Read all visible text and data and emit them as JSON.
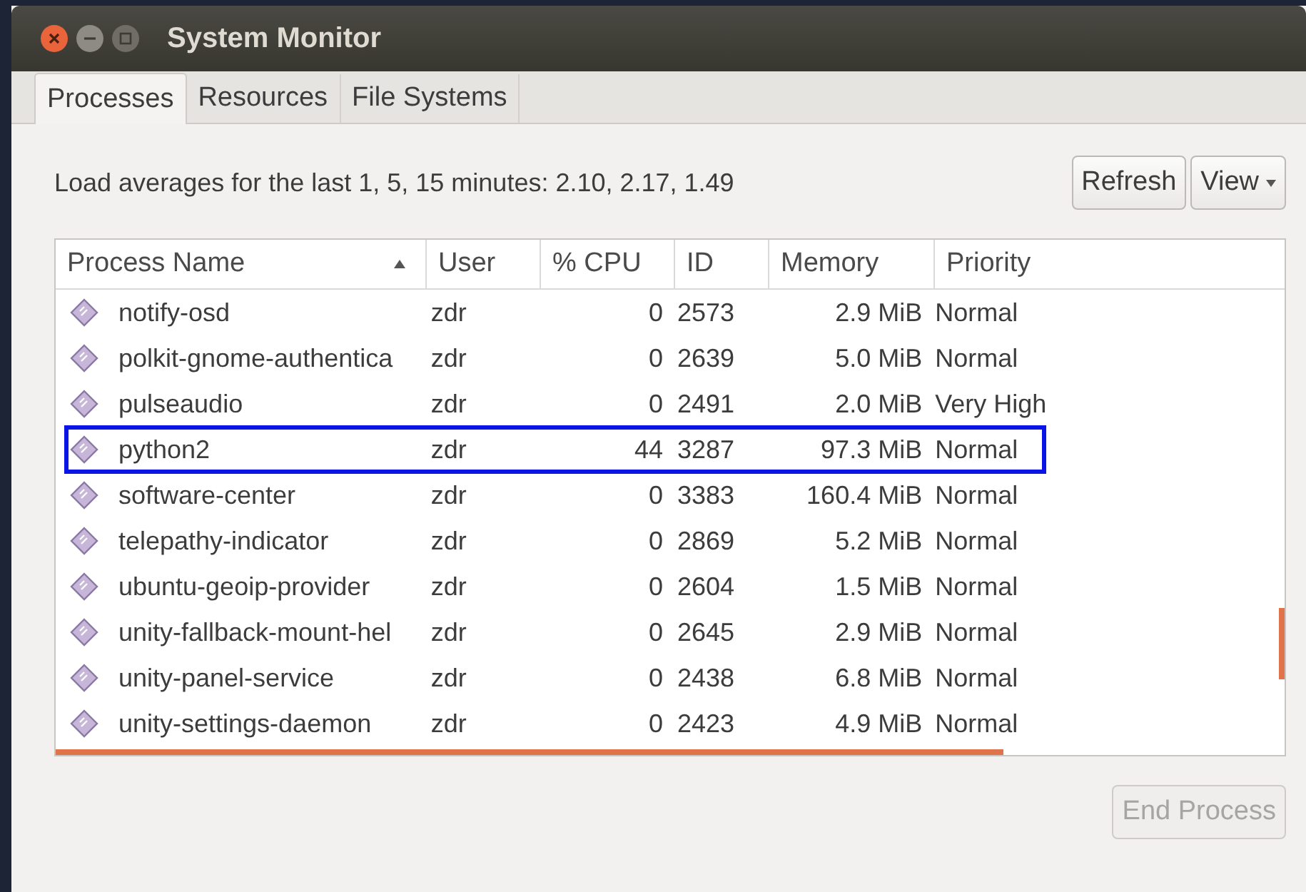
{
  "window": {
    "title": "System Monitor"
  },
  "tabs": [
    {
      "label": "Processes",
      "selected": true
    },
    {
      "label": "Resources",
      "selected": false
    },
    {
      "label": "File Systems",
      "selected": false
    }
  ],
  "load_averages": "Load averages for the last 1, 5, 15 minutes: 2.10, 2.17, 1.49",
  "toolbar": {
    "refresh": "Refresh",
    "view": "View"
  },
  "table": {
    "columns": [
      {
        "label": "Process Name",
        "sorted": true
      },
      {
        "label": "User",
        "sorted": false
      },
      {
        "label": "% CPU",
        "sorted": false
      },
      {
        "label": "ID",
        "sorted": false
      },
      {
        "label": "Memory",
        "sorted": false
      },
      {
        "label": "Priority",
        "sorted": false
      }
    ],
    "rows": [
      {
        "name": "notify-osd",
        "user": "zdr",
        "cpu": "0",
        "id": "2573",
        "memory": "2.9 MiB",
        "priority": "Normal",
        "highlighted": false
      },
      {
        "name": "polkit-gnome-authentica",
        "user": "zdr",
        "cpu": "0",
        "id": "2639",
        "memory": "5.0 MiB",
        "priority": "Normal",
        "highlighted": false
      },
      {
        "name": "pulseaudio",
        "user": "zdr",
        "cpu": "0",
        "id": "2491",
        "memory": "2.0 MiB",
        "priority": "Very High",
        "highlighted": false
      },
      {
        "name": "python2",
        "user": "zdr",
        "cpu": "44",
        "id": "3287",
        "memory": "97.3 MiB",
        "priority": "Normal",
        "highlighted": true
      },
      {
        "name": "software-center",
        "user": "zdr",
        "cpu": "0",
        "id": "3383",
        "memory": "160.4 MiB",
        "priority": "Normal",
        "highlighted": false
      },
      {
        "name": "telepathy-indicator",
        "user": "zdr",
        "cpu": "0",
        "id": "2869",
        "memory": "5.2 MiB",
        "priority": "Normal",
        "highlighted": false
      },
      {
        "name": "ubuntu-geoip-provider",
        "user": "zdr",
        "cpu": "0",
        "id": "2604",
        "memory": "1.5 MiB",
        "priority": "Normal",
        "highlighted": false
      },
      {
        "name": "unity-fallback-mount-hel",
        "user": "zdr",
        "cpu": "0",
        "id": "2645",
        "memory": "2.9 MiB",
        "priority": "Normal",
        "highlighted": false
      },
      {
        "name": "unity-panel-service",
        "user": "zdr",
        "cpu": "0",
        "id": "2438",
        "memory": "6.8 MiB",
        "priority": "Normal",
        "highlighted": false
      },
      {
        "name": "unity-settings-daemon",
        "user": "zdr",
        "cpu": "0",
        "id": "2423",
        "memory": "4.9 MiB",
        "priority": "Normal",
        "highlighted": false
      }
    ]
  },
  "end_process": {
    "label": "End Process",
    "disabled": true
  }
}
